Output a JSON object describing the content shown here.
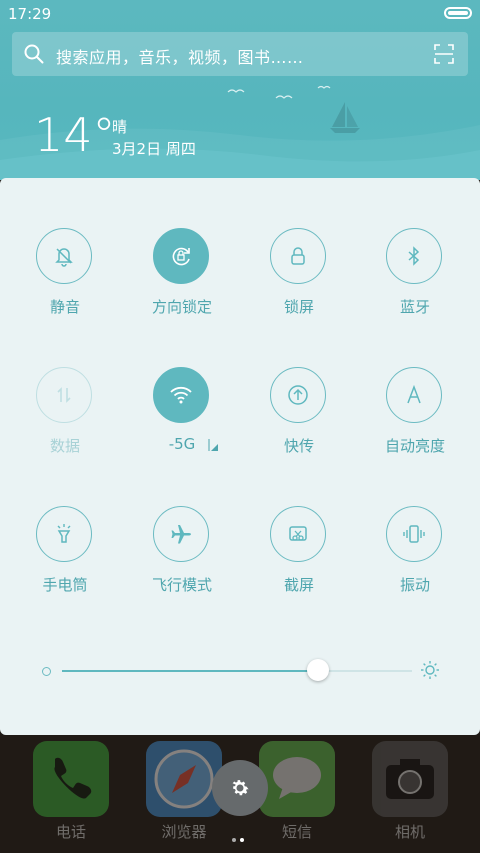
{
  "status": {
    "time": "17:29"
  },
  "search": {
    "placeholder": "搜索应用，音乐，视频，图书……"
  },
  "weather": {
    "temperature": "14°",
    "condition": "晴",
    "date": "3月2日 周四"
  },
  "toggles": [
    {
      "label": "静音",
      "icon": "mute-bell-icon",
      "state": "off"
    },
    {
      "label": "方向锁定",
      "icon": "rotation-lock-icon",
      "state": "on"
    },
    {
      "label": "锁屏",
      "icon": "lock-icon",
      "state": "off"
    },
    {
      "label": "蓝牙",
      "icon": "bluetooth-icon",
      "state": "off"
    },
    {
      "label": "数据",
      "icon": "mobile-data-icon",
      "state": "disabled"
    },
    {
      "label": "-5G",
      "icon": "wifi-icon",
      "state": "on"
    },
    {
      "label": "快传",
      "icon": "quick-transfer-icon",
      "state": "off"
    },
    {
      "label": "自动亮度",
      "icon": "auto-brightness-icon",
      "state": "off"
    },
    {
      "label": "手电筒",
      "icon": "flashlight-icon",
      "state": "off"
    },
    {
      "label": "飞行模式",
      "icon": "airplane-icon",
      "state": "off"
    },
    {
      "label": "截屏",
      "icon": "screenshot-icon",
      "state": "off"
    },
    {
      "label": "振动",
      "icon": "vibrate-icon",
      "state": "off"
    }
  ],
  "brightness": {
    "level": 0.73
  },
  "dock": {
    "apps": [
      {
        "label": "电话",
        "icon": "phone-icon",
        "color": "#3aa83a"
      },
      {
        "label": "浏览器",
        "icon": "compass-icon",
        "color": "#3f8fd6"
      },
      {
        "label": "短信",
        "icon": "message-icon",
        "color": "#5cb84a"
      },
      {
        "label": "相机",
        "icon": "camera-icon",
        "color": "#555555"
      }
    ]
  },
  "colors": {
    "accent": "#5fb8bf",
    "panel": "#eaf3f4"
  }
}
